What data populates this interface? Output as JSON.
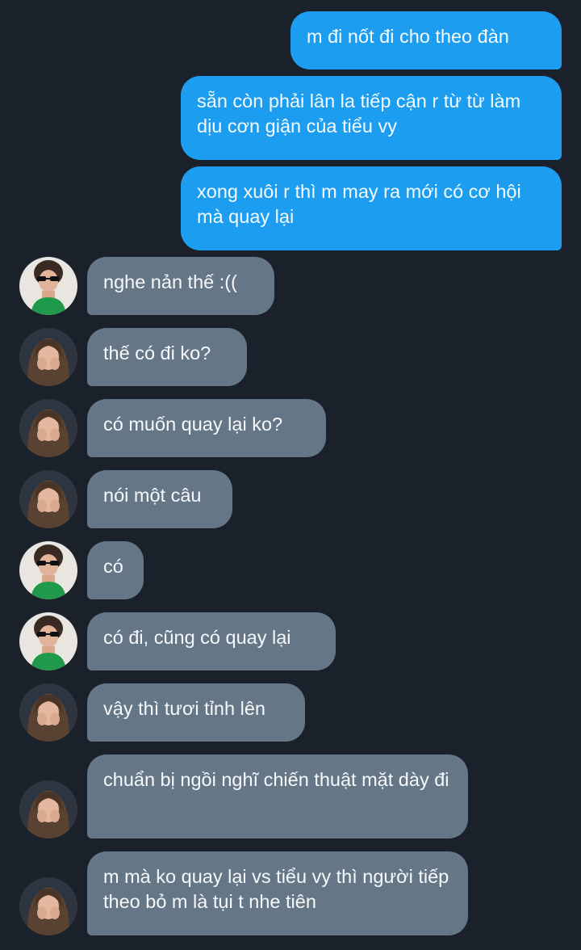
{
  "conversation": {
    "messages": [
      {
        "id": "m1",
        "direction": "outgoing",
        "text": "m đi nốt đi cho theo đàn"
      },
      {
        "id": "m2",
        "direction": "outgoing",
        "text": "sẵn còn phải lân la tiếp cận r từ từ làm dịu cơn giận của tiểu vy"
      },
      {
        "id": "m3",
        "direction": "outgoing",
        "text": "xong xuôi r thì m may ra mới có cơ hội mà quay lại"
      },
      {
        "id": "m4",
        "direction": "incoming",
        "avatar": "green-top-sunglasses-avatar",
        "text": "nghe nản thế :(("
      },
      {
        "id": "m5",
        "direction": "incoming",
        "avatar": "long-hair-girl-avatar",
        "text": "thế có đi ko?"
      },
      {
        "id": "m6",
        "direction": "incoming",
        "avatar": "long-hair-girl-avatar",
        "text": "có muốn quay lại ko?"
      },
      {
        "id": "m7",
        "direction": "incoming",
        "avatar": "long-hair-girl-avatar",
        "text": "nói một câu"
      },
      {
        "id": "m8",
        "direction": "incoming",
        "avatar": "green-top-sunglasses-avatar",
        "text": "có"
      },
      {
        "id": "m9",
        "direction": "incoming",
        "avatar": "green-top-sunglasses-avatar",
        "text": "có đi, cũng có quay lại"
      },
      {
        "id": "m10",
        "direction": "incoming",
        "avatar": "long-hair-girl-avatar",
        "text": "vậy thì tươi tỉnh lên"
      },
      {
        "id": "m11",
        "direction": "incoming",
        "avatar": "long-hair-girl-avatar",
        "text": "chuẩn bị ngồi nghĩ chiến thuật mặt dày đi"
      },
      {
        "id": "m12",
        "direction": "incoming",
        "avatar": "long-hair-girl-avatar",
        "text": "m mà ko quay lại vs tiểu vy thì người tiếp theo bỏ m là tụi t nhe tiên"
      }
    ]
  },
  "colors": {
    "background": "#1a212b",
    "outgoing_bubble": "#1c9df0",
    "incoming_bubble": "#657787"
  }
}
